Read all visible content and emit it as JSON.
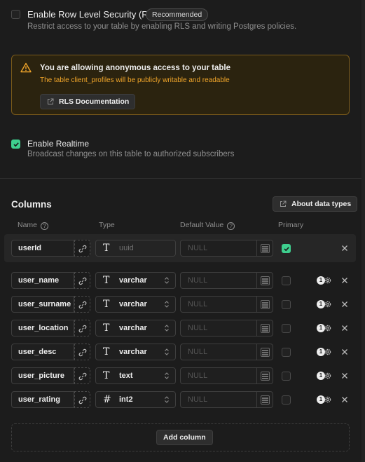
{
  "rls": {
    "title": "Enable Row Level Security (RLS)",
    "badge": "Recommended",
    "description": "Restrict access to your table by enabling RLS and writing Postgres policies.",
    "checked": false
  },
  "warning": {
    "title": "You are allowing anonymous access to your table",
    "message": "The table client_profiles will be publicly writable and readable",
    "button": "RLS Documentation"
  },
  "realtime": {
    "title": "Enable Realtime",
    "description": "Broadcast changes on this table to authorized subscribers",
    "checked": true
  },
  "columns": {
    "heading": "Columns",
    "about_button": "About data types",
    "headers": {
      "name": "Name",
      "type": "Type",
      "default": "Default Value",
      "primary": "Primary"
    },
    "default_placeholder": "NULL",
    "rows": [
      {
        "name": "userId",
        "type": "uuid",
        "type_icon": "T",
        "primary": true,
        "settings_count": ""
      },
      {
        "name": "user_name",
        "type": "varchar",
        "type_icon": "T",
        "primary": false,
        "settings_count": "1"
      },
      {
        "name": "user_surname",
        "type": "varchar",
        "type_icon": "T",
        "primary": false,
        "settings_count": "1"
      },
      {
        "name": "user_location",
        "type": "varchar",
        "type_icon": "T",
        "primary": false,
        "settings_count": "1"
      },
      {
        "name": "user_desc",
        "type": "varchar",
        "type_icon": "T",
        "primary": false,
        "settings_count": "1"
      },
      {
        "name": "user_picture",
        "type": "text",
        "type_icon": "T",
        "primary": false,
        "settings_count": "1"
      },
      {
        "name": "user_rating",
        "type": "int2",
        "type_icon": "#",
        "primary": false,
        "settings_count": "1"
      }
    ],
    "add_button": "Add column"
  },
  "colors": {
    "background": "#1c1c1c",
    "accent_green": "#3ecf8e",
    "warning_border": "#7a5a1a",
    "warning_text": "#f0a52a"
  },
  "icons": {
    "warning": "warning-triangle-icon",
    "external": "external-link-icon",
    "help": "help-circle-icon",
    "link": "link-icon",
    "chevron": "chevron-up-down-icon",
    "list": "list-icon",
    "gear": "gear-icon",
    "close": "close-icon"
  }
}
